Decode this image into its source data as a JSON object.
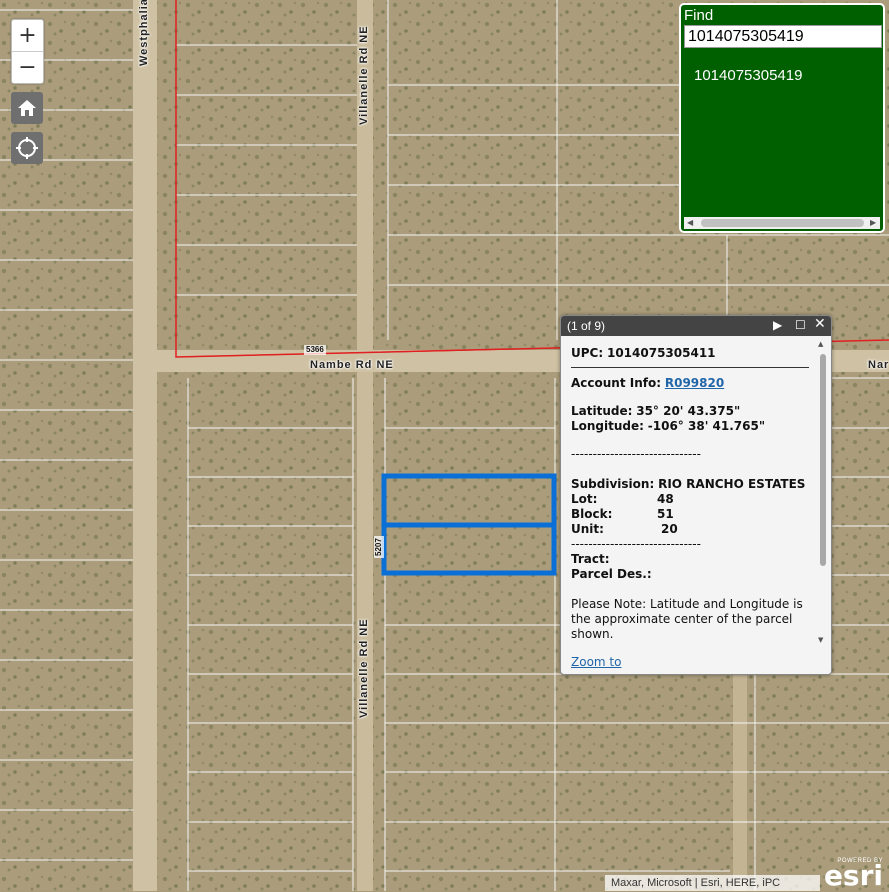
{
  "map": {
    "roads": {
      "westphalia": "Westphalia",
      "villanelle_north": "Villanelle Rd NE",
      "villanelle_south": "Villanelle Rd NE",
      "nambe": "Nambe Rd NE",
      "nambe_right": "Nar"
    },
    "route_numbers": {
      "nambe": "5366",
      "villanelle": "5207"
    },
    "parcel_line_color": "#ffffff",
    "boundary_color": "#e02020",
    "highlight_color": "#0a6fd6"
  },
  "controls": {
    "zoom_in": "+",
    "zoom_out": "−",
    "home_icon": "home-icon",
    "locate_icon": "locate-icon"
  },
  "find": {
    "title": "Find",
    "query": "1014075305419",
    "result": "1014075305419",
    "bg_color": "#006000"
  },
  "popup": {
    "count": "(1 of 9)",
    "upc_label": "UPC:",
    "upc_value": "1014075305411",
    "account_label": "Account Info:",
    "account_value": "R099820",
    "lat_label": "Latitude:",
    "lat_value": "35° 20' 43.375\"",
    "lon_label": "Longitude:",
    "lon_value": "-106° 38' 41.765\"",
    "separator": "------------------------------",
    "subdivision_label": "Subdivision:",
    "subdivision_value": "RIO RANCHO ESTATES",
    "lot_label": "Lot:",
    "lot_value": "48",
    "block_label": "Block:",
    "block_value": "51",
    "unit_label": "Unit:",
    "unit_value": "20",
    "separator2": "------------------------------",
    "tract_label": "Tract:",
    "parcel_label": "Parcel Des.:",
    "note": "Please Note: Latitude and Longitude is the approximate center of the parcel shown.",
    "zoom_to": "Zoom to"
  },
  "attribution": "Maxar, Microsoft | Esri, HERE, iPC",
  "esri": {
    "powered": "POWERED BY",
    "logo": "esri"
  }
}
